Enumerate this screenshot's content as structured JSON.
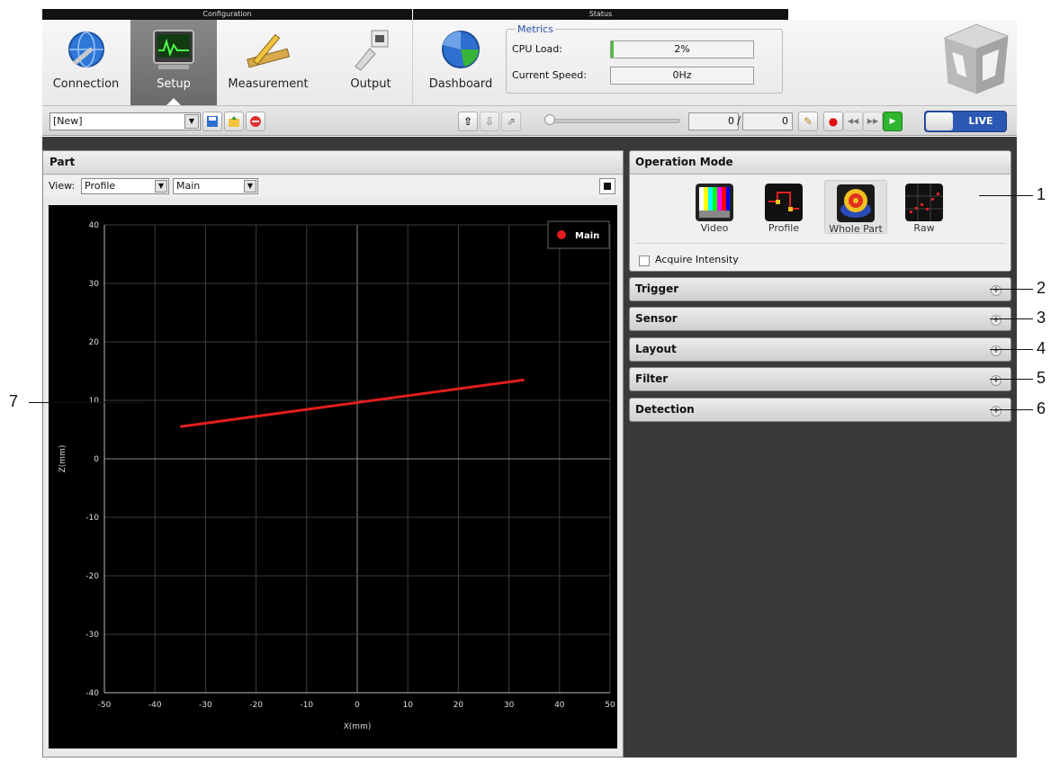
{
  "ribbon": {
    "group_configuration": "Configuration",
    "group_status": "Status",
    "buttons": [
      {
        "label": "Connection",
        "icon": "globe-wrench-icon"
      },
      {
        "label": "Setup",
        "icon": "monitor-waveform-icon"
      },
      {
        "label": "Measurement",
        "icon": "ruler-pencil-icon"
      },
      {
        "label": "Output",
        "icon": "ethernet-plug-icon"
      },
      {
        "label": "Dashboard",
        "icon": "pie-globe-icon"
      }
    ],
    "metrics": {
      "title": "Metrics",
      "cpu_label": "CPU Load:",
      "cpu_value": "2%",
      "cpu_fraction": 0.02,
      "speed_label": "Current Speed:",
      "speed_value": "0Hz"
    }
  },
  "toolbar": {
    "job_name": "[New]",
    "frame_current": "0",
    "frame_separator": "/",
    "frame_total": "0",
    "live_label": "LIVE"
  },
  "part_panel": {
    "title": "Part",
    "view_label": "View:",
    "view_value": "Profile",
    "source_value": "Main"
  },
  "chart_data": {
    "type": "line",
    "xlabel": "X(mm)",
    "ylabel": "Z(mm)",
    "xlim": [
      -50,
      50
    ],
    "ylim": [
      -40,
      40
    ],
    "xticks": [
      -50,
      -40,
      -30,
      -20,
      -10,
      0,
      10,
      20,
      30,
      40,
      50
    ],
    "yticks": [
      -40,
      -30,
      -20,
      -10,
      0,
      10,
      20,
      30,
      40
    ],
    "grid": true,
    "legend_position": "top-right",
    "series": [
      {
        "name": "Main",
        "color": "#e21d1d",
        "x": [
          -35,
          33
        ],
        "y": [
          5.5,
          13.5
        ]
      }
    ]
  },
  "operation_mode": {
    "title": "Operation Mode",
    "modes": [
      {
        "label": "Video",
        "icon": "color-bars-icon"
      },
      {
        "label": "Profile",
        "icon": "profile-icon"
      },
      {
        "label": "Whole Part",
        "icon": "whole-part-icon"
      },
      {
        "label": "Raw",
        "icon": "raw-data-icon"
      }
    ],
    "acquire_intensity_label": "Acquire Intensity"
  },
  "panels": [
    "Trigger",
    "Sensor",
    "Layout",
    "Filter",
    "Detection"
  ],
  "callouts": [
    "1",
    "2",
    "3",
    "4",
    "5",
    "6",
    "7"
  ]
}
